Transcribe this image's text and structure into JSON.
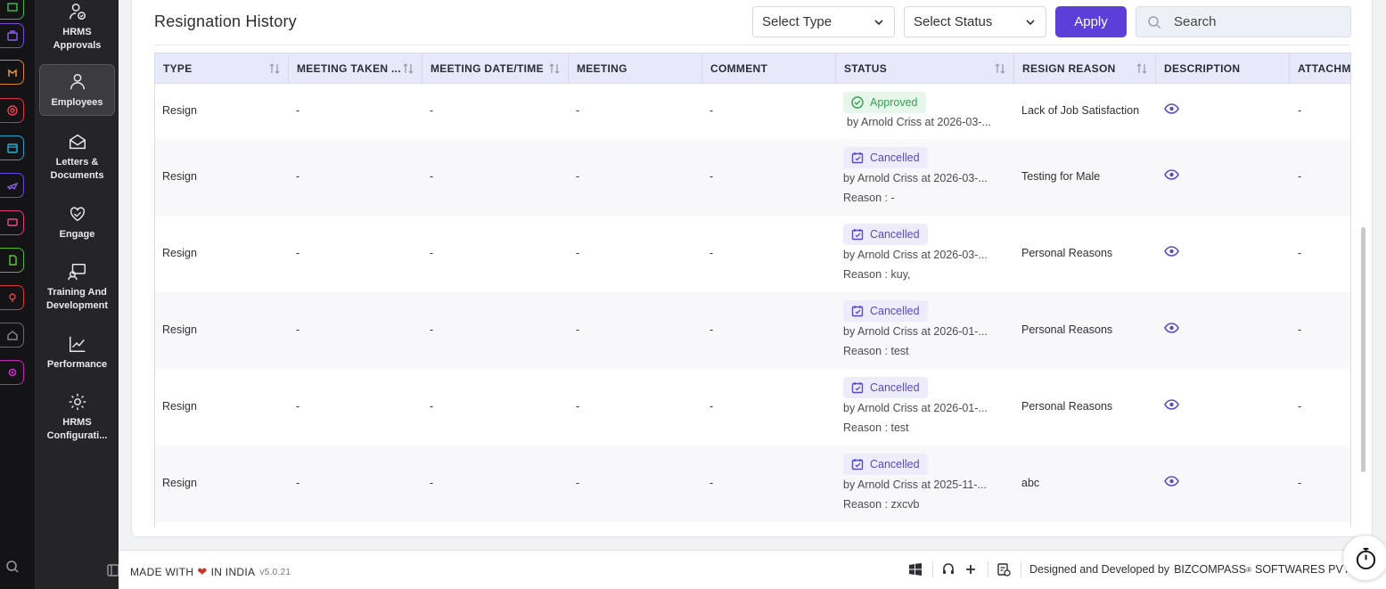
{
  "nav": {
    "items": [
      {
        "label": "HRMS Approvals"
      },
      {
        "label": "Employees"
      },
      {
        "label": "Letters & Documents"
      },
      {
        "label": "Engage"
      },
      {
        "label": "Training And Development"
      },
      {
        "label": "Performance"
      },
      {
        "label": "HRMS Configurati..."
      }
    ]
  },
  "page": {
    "title": "Resignation History",
    "type_select": "Select Type",
    "status_select": "Select Status",
    "apply_label": "Apply",
    "search_placeholder": "Search"
  },
  "table": {
    "columns": [
      "TYPE",
      "MEETING TAKEN ...",
      "MEETING DATE/TIME",
      "MEETING",
      "COMMENT",
      "STATUS",
      "RESIGN REASON",
      "DESCRIPTION",
      "ATTACHM"
    ],
    "rows": [
      {
        "type": "Resign",
        "meeting_taken": "-",
        "meeting_datetime": "-",
        "meeting": "-",
        "comment": "-",
        "status": "Approved",
        "status_by": "by Arnold Criss at 2026-03-...",
        "status_reason": "",
        "resign_reason": "Lack of Job Satisfaction",
        "attachment": "-"
      },
      {
        "type": "Resign",
        "meeting_taken": "-",
        "meeting_datetime": "-",
        "meeting": "-",
        "comment": "-",
        "status": "Cancelled",
        "status_by": "by Arnold Criss at 2026-03-...",
        "status_reason": "Reason : -",
        "resign_reason": "Testing for Male",
        "attachment": "-"
      },
      {
        "type": "Resign",
        "meeting_taken": "-",
        "meeting_datetime": "-",
        "meeting": "-",
        "comment": "-",
        "status": "Cancelled",
        "status_by": "by Arnold Criss at 2026-03-...",
        "status_reason": "Reason : kuy,",
        "resign_reason": "Personal Reasons",
        "attachment": "-"
      },
      {
        "type": "Resign",
        "meeting_taken": "-",
        "meeting_datetime": "-",
        "meeting": "-",
        "comment": "-",
        "status": "Cancelled",
        "status_by": "by Arnold Criss at 2026-01-...",
        "status_reason": "Reason : test",
        "resign_reason": "Personal Reasons",
        "attachment": "-"
      },
      {
        "type": "Resign",
        "meeting_taken": "-",
        "meeting_datetime": "-",
        "meeting": "-",
        "comment": "-",
        "status": "Cancelled",
        "status_by": "by Arnold Criss at 2026-01-...",
        "status_reason": "Reason : test",
        "resign_reason": "Personal Reasons",
        "attachment": "-"
      },
      {
        "type": "Resign",
        "meeting_taken": "-",
        "meeting_datetime": "-",
        "meeting": "-",
        "comment": "-",
        "status": "Cancelled",
        "status_by": "by Arnold Criss at 2025-11-...",
        "status_reason": "Reason : zxcvb",
        "resign_reason": "abc",
        "attachment": "-"
      }
    ]
  },
  "footer": {
    "made_with": "MADE WITH",
    "heart": "❤",
    "in_india": "IN INDIA",
    "version": "v5.0.21",
    "designed_by": "Designed and Developed by",
    "company": "BIZCOMPASS",
    "reg": "®",
    "company_tail": "SOFTWARES PVT"
  },
  "colors": {
    "accent": "#5b3fd8",
    "approved": "#3a9e53",
    "cancelled": "#5a49c6",
    "sidebar": "#252528"
  }
}
